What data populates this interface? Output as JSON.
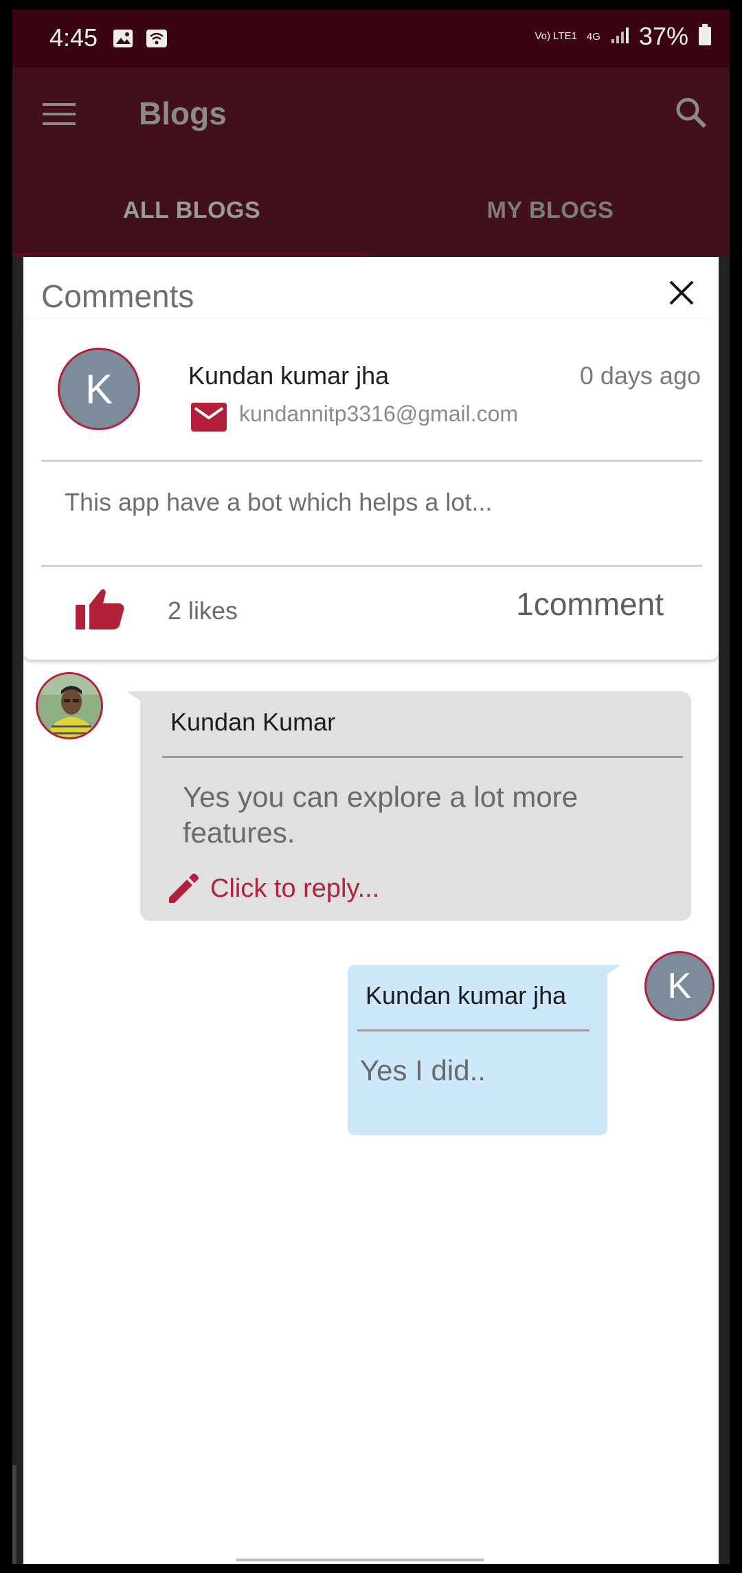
{
  "status_bar": {
    "time": "4:45",
    "network_label": "Vo) LTE1",
    "network_type": "4G",
    "battery": "37%",
    "icons": [
      "image-icon",
      "wifi-hotspot-icon",
      "signal-icon",
      "battery-icon"
    ]
  },
  "app_bar": {
    "title": "Blogs",
    "menu_icon": "menu-icon",
    "search_icon": "search-icon"
  },
  "tabs": [
    {
      "label": "ALL BLOGS",
      "selected": true
    },
    {
      "label": "MY BLOGS",
      "selected": false
    }
  ],
  "comments_panel": {
    "title": "Comments",
    "close_icon": "close-icon",
    "post": {
      "avatar_letter": "K",
      "author": "Kundan kumar jha",
      "time": "0 days ago",
      "email": "kundannitp3316@gmail.com",
      "text": "This app have a bot which helps a lot...",
      "likes": "2 likes",
      "comments": "1comment"
    },
    "replies": [
      {
        "author": "Kundan Kumar",
        "text": "Yes you can explore a lot more features.",
        "reply_prompt": "Click to reply..."
      },
      {
        "author": "Kundan kumar jha",
        "avatar_letter": "K",
        "text": "Yes I did.."
      }
    ]
  },
  "colors": {
    "accent": "#b3203a",
    "app_bar": "#42101a",
    "status_bar": "#3a0510",
    "reply_bubble_gray": "#e0e0e0",
    "reply_bubble_blue": "#cde7fb"
  }
}
